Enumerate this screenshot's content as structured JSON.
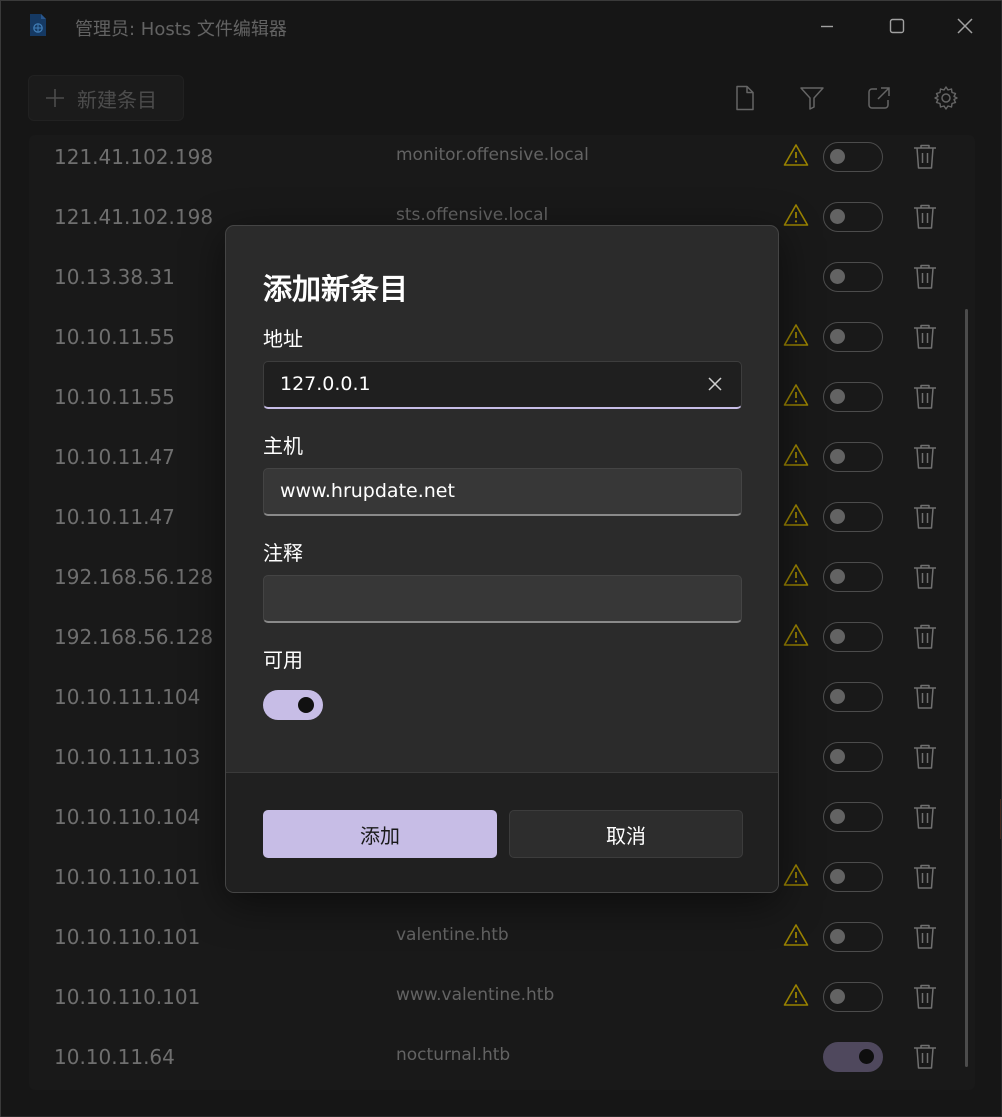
{
  "window": {
    "title": "管理员: Hosts 文件编辑器"
  },
  "toolbar": {
    "new_entry_label": "新建条目"
  },
  "entries": [
    {
      "address": "121.41.102.198",
      "host": "monitor.offensive.local",
      "warning": true,
      "enabled": false
    },
    {
      "address": "121.41.102.198",
      "host": "sts.offensive.local",
      "warning": true,
      "enabled": false
    },
    {
      "address": "10.13.38.31",
      "host": "",
      "warning": false,
      "enabled": false
    },
    {
      "address": "10.10.11.55",
      "host": "",
      "warning": true,
      "enabled": false
    },
    {
      "address": "10.10.11.55",
      "host": "",
      "warning": true,
      "enabled": false
    },
    {
      "address": "10.10.11.47",
      "host": "",
      "warning": true,
      "enabled": false
    },
    {
      "address": "10.10.11.47",
      "host": "",
      "warning": true,
      "enabled": false
    },
    {
      "address": "192.168.56.128",
      "host": "",
      "warning": true,
      "enabled": false
    },
    {
      "address": "192.168.56.128",
      "host": "",
      "warning": true,
      "enabled": false
    },
    {
      "address": "10.10.111.104",
      "host": "",
      "warning": false,
      "enabled": false
    },
    {
      "address": "10.10.111.103",
      "host": "",
      "warning": false,
      "enabled": false
    },
    {
      "address": "10.10.110.104",
      "host": "",
      "warning": false,
      "enabled": false
    },
    {
      "address": "10.10.110.101",
      "host": "",
      "warning": true,
      "enabled": false
    },
    {
      "address": "10.10.110.101",
      "host": "valentine.htb",
      "warning": true,
      "enabled": false
    },
    {
      "address": "10.10.110.101",
      "host": "www.valentine.htb",
      "warning": true,
      "enabled": false
    },
    {
      "address": "10.10.11.64",
      "host": "nocturnal.htb",
      "warning": false,
      "enabled": true
    }
  ],
  "dialog": {
    "title": "添加新条目",
    "address_label": "地址",
    "address_value": "127.0.0.1",
    "host_label": "主机",
    "host_value": "www.hrupdate.net",
    "comment_label": "注释",
    "comment_value": "",
    "enabled_label": "可用",
    "enabled": true,
    "add_button": "添加",
    "cancel_button": "取消"
  },
  "colors": {
    "accent": "#c7bde6",
    "warning": "#d4b400",
    "background": "#1f1f1f"
  }
}
